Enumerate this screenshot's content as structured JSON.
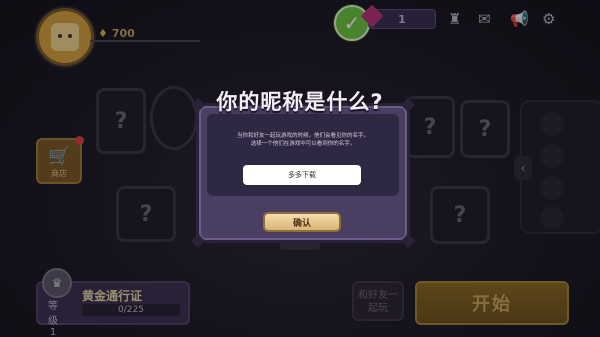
{
  "topbar": {
    "coins": "700",
    "gems": "1",
    "icons": [
      "trophy-icon",
      "mail-icon",
      "megaphone-icon",
      "gear-icon"
    ]
  },
  "shop": {
    "label": "商店"
  },
  "pass": {
    "title": "黄金通行证",
    "level_label": "等级",
    "level": "1",
    "progress": "0/225"
  },
  "buttons": {
    "friends": "和好友一起玩",
    "start": "开始"
  },
  "dialog": {
    "title": "你的昵称是什么?",
    "description_line1": "当你和好友一起玩游戏的时候，他们会看见你的名字。",
    "description_line2": "选择一个他们在游戏中可以看到你的名字。",
    "name_value": "多多下载",
    "confirm_label": "确认"
  },
  "colors": {
    "accent_gold": "#d9b577",
    "panel_purple": "#4a3f63",
    "check_green": "#6cc640"
  }
}
